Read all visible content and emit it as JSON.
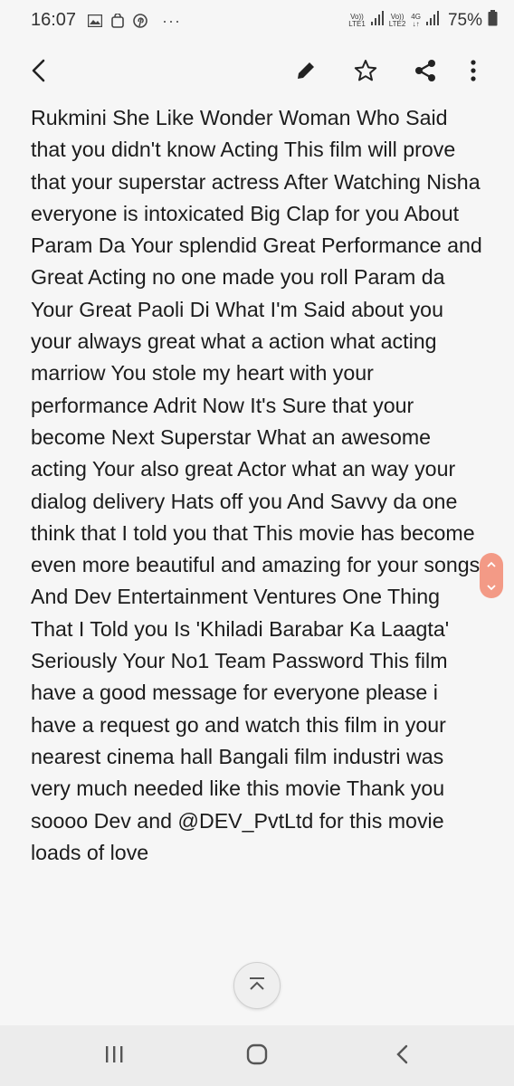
{
  "status_bar": {
    "time": "16:07",
    "left_icons": [
      "image-icon",
      "bag-icon",
      "pinterest-icon"
    ],
    "overflow": "···",
    "sim1_top": "Vo))",
    "sim1_bottom": "LTE1",
    "sim2_top": "Vo))",
    "sim2_bottom": "LTE2",
    "network_type": "4G",
    "battery": "75%"
  },
  "toolbar": {
    "back_icon": "back-arrow-icon",
    "edit_icon": "pencil-icon",
    "favorite_icon": "star-icon",
    "share_icon": "share-icon",
    "more_icon": "more-vertical-icon"
  },
  "article": {
    "text": "Rukmini She Like Wonder Woman Who Said that you didn't know Acting This film will prove that your superstar actress After Watching Nisha everyone is intoxicated Big Clap for you About Param Da Your splendid Great Performance and Great Acting no one made you roll Param da Your Great Paoli Di What I'm Said about you your always great what a action what acting marriow You stole my heart with your performance Adrit Now It's Sure that your become Next Superstar What an awesome acting Your also great Actor what an way your dialog delivery Hats off you And Savvy da one think that I told you that This movie has become even more beautiful and amazing for your songs And Dev Entertainment Ventures One Thing That I Told you Is 'Khiladi Barabar Ka Laagta' Seriously Your No1 Team Password This film have a good message for everyone please i have a request go and watch this film in your nearest cinema hall Bangali film industri was very much needed like this movie Thank you soooo Dev and @DEV_PvtLtd for this movie loads of love"
  },
  "controls": {
    "scroller_color": "#f39a86",
    "scroll_top_icon": "chevron-up-bar-icon"
  },
  "nav_bar": {
    "recents_icon": "recents-icon",
    "home_icon": "home-icon",
    "back_icon": "nav-back-icon"
  }
}
